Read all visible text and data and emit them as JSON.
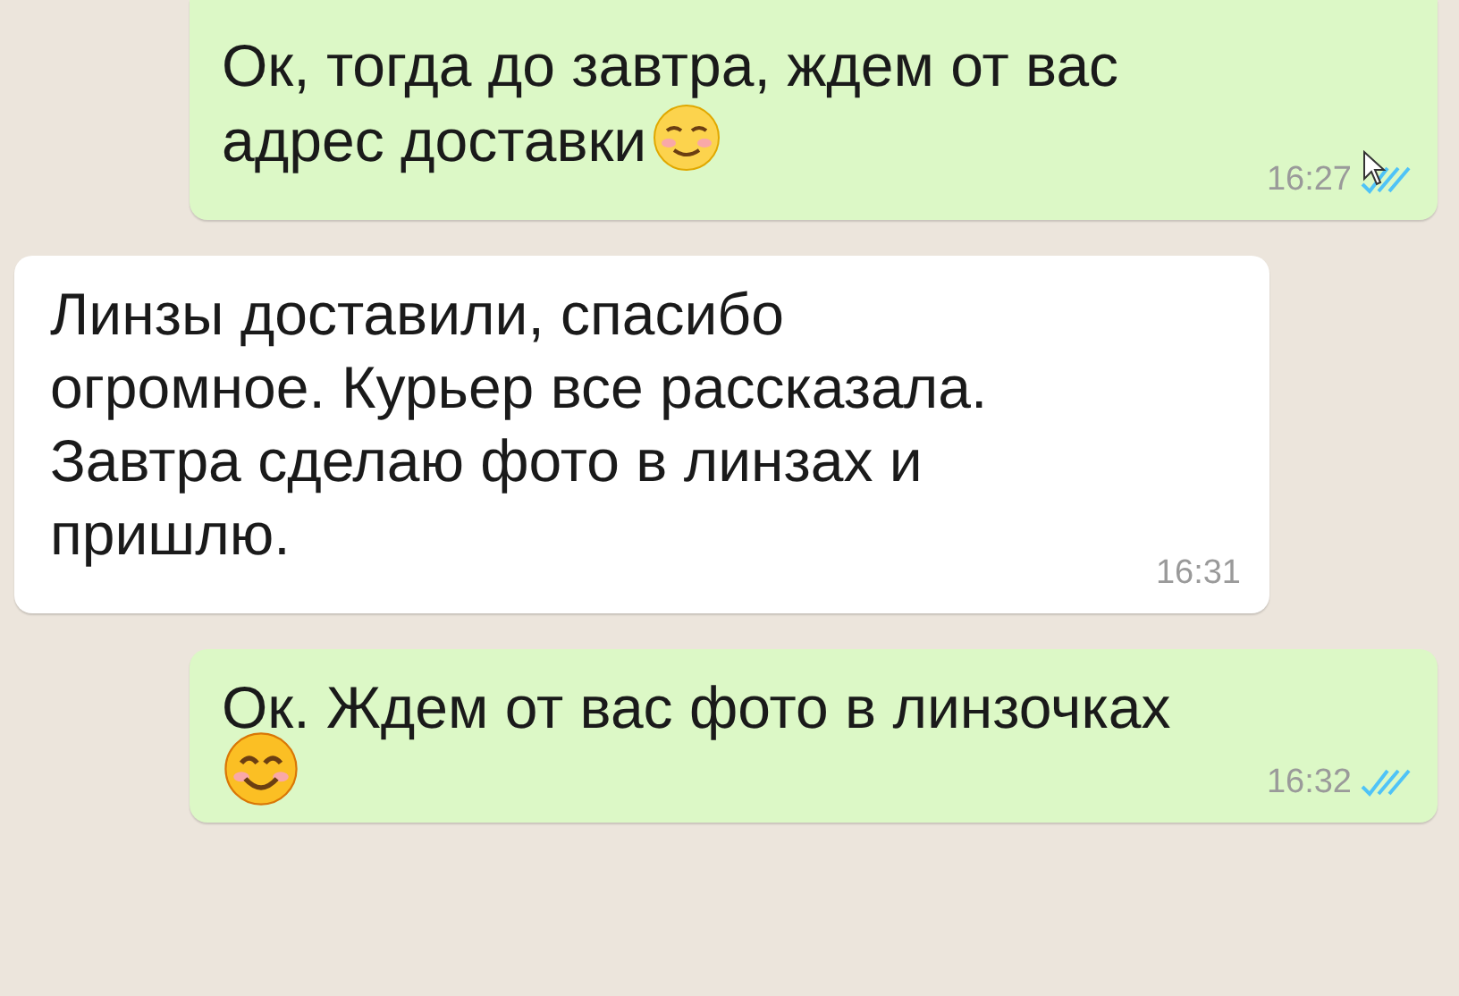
{
  "messages": [
    {
      "kind": "outgoing",
      "lines": [
        "Ок, тогда до завтра, ждем от вас",
        "адрес доставки"
      ],
      "emoji": {
        "kind": "relieved"
      },
      "time": "16:27",
      "read": true
    },
    {
      "kind": "incoming",
      "lines": [
        "Линзы доставили, спасибо",
        "огромное. Курьер все рассказала.",
        "Завтра сделаю фото в линзах и",
        "пришлю."
      ],
      "time": "16:31"
    },
    {
      "kind": "outgoing",
      "lines": [
        "Ок. Ждем от вас фото в линзочках"
      ],
      "emoji": {
        "kind": "smile"
      },
      "time": "16:32",
      "read": true
    }
  ]
}
